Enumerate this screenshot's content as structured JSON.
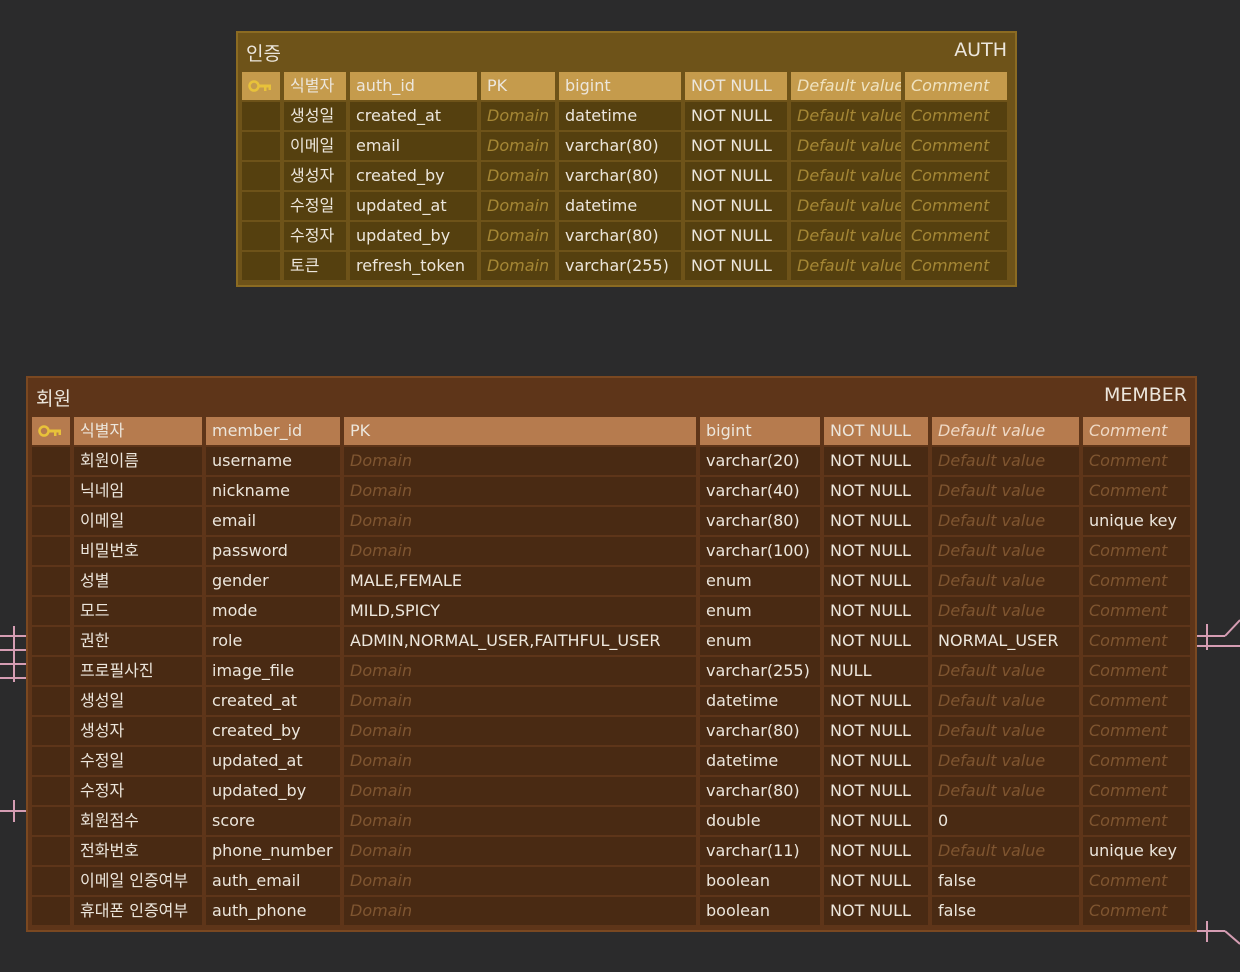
{
  "auth": {
    "title_ko": "인증",
    "title_en": "AUTH",
    "rows": [
      {
        "pk": true,
        "logical": "식별자",
        "physical": "auth_id",
        "domain": "PK",
        "type": "bigint",
        "null": "NOT NULL",
        "default": "Default value",
        "comment": "Comment"
      },
      {
        "pk": false,
        "logical": "생성일",
        "physical": "created_at",
        "domain": "Domain",
        "type": "datetime",
        "null": "NOT NULL",
        "default": "Default value",
        "comment": "Comment"
      },
      {
        "pk": false,
        "logical": "이메일",
        "physical": "email",
        "domain": "Domain",
        "type": "varchar(80)",
        "null": "NOT NULL",
        "default": "Default value",
        "comment": "Comment"
      },
      {
        "pk": false,
        "logical": "생성자",
        "physical": "created_by",
        "domain": "Domain",
        "type": "varchar(80)",
        "null": "NOT NULL",
        "default": "Default value",
        "comment": "Comment"
      },
      {
        "pk": false,
        "logical": "수정일",
        "physical": "updated_at",
        "domain": "Domain",
        "type": "datetime",
        "null": "NOT NULL",
        "default": "Default value",
        "comment": "Comment"
      },
      {
        "pk": false,
        "logical": "수정자",
        "physical": "updated_by",
        "domain": "Domain",
        "type": "varchar(80)",
        "null": "NOT NULL",
        "default": "Default value",
        "comment": "Comment"
      },
      {
        "pk": false,
        "logical": "토큰",
        "physical": "refresh_token",
        "domain": "Domain",
        "type": "varchar(255)",
        "null": "NOT NULL",
        "default": "Default value",
        "comment": "Comment"
      }
    ]
  },
  "member": {
    "title_ko": "회원",
    "title_en": "MEMBER",
    "rows": [
      {
        "pk": true,
        "logical": "식별자",
        "physical": "member_id",
        "domain": "PK",
        "type": "bigint",
        "null": "NOT NULL",
        "default": "Default value",
        "comment": "Comment"
      },
      {
        "pk": false,
        "logical": "회원이름",
        "physical": "username",
        "domain": "Domain",
        "type": "varchar(20)",
        "null": "NOT NULL",
        "default": "Default value",
        "comment": "Comment"
      },
      {
        "pk": false,
        "logical": "닉네임",
        "physical": "nickname",
        "domain": "Domain",
        "type": "varchar(40)",
        "null": "NOT NULL",
        "default": "Default value",
        "comment": "Comment"
      },
      {
        "pk": false,
        "logical": "이메일",
        "physical": "email",
        "domain": "Domain",
        "type": "varchar(80)",
        "null": "NOT NULL",
        "default": "Default value",
        "comment": "unique key"
      },
      {
        "pk": false,
        "logical": "비밀번호",
        "physical": "password",
        "domain": "Domain",
        "type": "varchar(100)",
        "null": "NOT NULL",
        "default": "Default value",
        "comment": "Comment"
      },
      {
        "pk": false,
        "logical": "성별",
        "physical": "gender",
        "domain": "MALE,FEMALE",
        "type": "enum",
        "null": "NOT NULL",
        "default": "Default value",
        "comment": "Comment"
      },
      {
        "pk": false,
        "logical": "모드",
        "physical": "mode",
        "domain": "MILD,SPICY",
        "type": "enum",
        "null": "NOT NULL",
        "default": "Default value",
        "comment": "Comment"
      },
      {
        "pk": false,
        "logical": "권한",
        "physical": "role",
        "domain": "ADMIN,NORMAL_USER,FAITHFUL_USER",
        "type": "enum",
        "null": "NOT NULL",
        "default": "NORMAL_USER",
        "comment": "Comment"
      },
      {
        "pk": false,
        "logical": "프로필사진",
        "physical": "image_file",
        "domain": "Domain",
        "type": "varchar(255)",
        "null": "NULL",
        "default": "Default value",
        "comment": "Comment"
      },
      {
        "pk": false,
        "logical": "생성일",
        "physical": "created_at",
        "domain": "Domain",
        "type": "datetime",
        "null": "NOT NULL",
        "default": "Default value",
        "comment": "Comment"
      },
      {
        "pk": false,
        "logical": "생성자",
        "physical": "created_by",
        "domain": "Domain",
        "type": "varchar(80)",
        "null": "NOT NULL",
        "default": "Default value",
        "comment": "Comment"
      },
      {
        "pk": false,
        "logical": "수정일",
        "physical": "updated_at",
        "domain": "Domain",
        "type": "datetime",
        "null": "NOT NULL",
        "default": "Default value",
        "comment": "Comment"
      },
      {
        "pk": false,
        "logical": "수정자",
        "physical": "updated_by",
        "domain": "Domain",
        "type": "varchar(80)",
        "null": "NOT NULL",
        "default": "Default value",
        "comment": "Comment"
      },
      {
        "pk": false,
        "logical": "회원점수",
        "physical": "score",
        "domain": "Domain",
        "type": "double",
        "null": "NOT NULL",
        "default": "0",
        "comment": "Comment"
      },
      {
        "pk": false,
        "logical": "전화번호",
        "physical": "phone_number",
        "domain": "Domain",
        "type": "varchar(11)",
        "null": "NOT NULL",
        "default": "Default value",
        "comment": "unique key"
      },
      {
        "pk": false,
        "logical": "이메일 인증여부",
        "physical": "auth_email",
        "domain": "Domain",
        "type": "boolean",
        "null": "NOT NULL",
        "default": "false",
        "comment": "Comment"
      },
      {
        "pk": false,
        "logical": "휴대폰 인증여부",
        "physical": "auth_phone",
        "domain": "Domain",
        "type": "boolean",
        "null": "NOT NULL",
        "default": "false",
        "comment": "Comment"
      }
    ]
  },
  "placeholders": [
    "Domain",
    "Default value",
    "Comment"
  ],
  "icons": {
    "primary_key": "key-icon",
    "relation": "relationship-line"
  },
  "colors": {
    "canvas": "#2b2b2c",
    "auth_header": "#6e5319",
    "auth_pk_row": "#c59b4c",
    "member_header": "#5e3519",
    "member_pk_row": "#b67b4e",
    "key_icon": "#e8c23a",
    "relation_line": "#d59db3"
  }
}
